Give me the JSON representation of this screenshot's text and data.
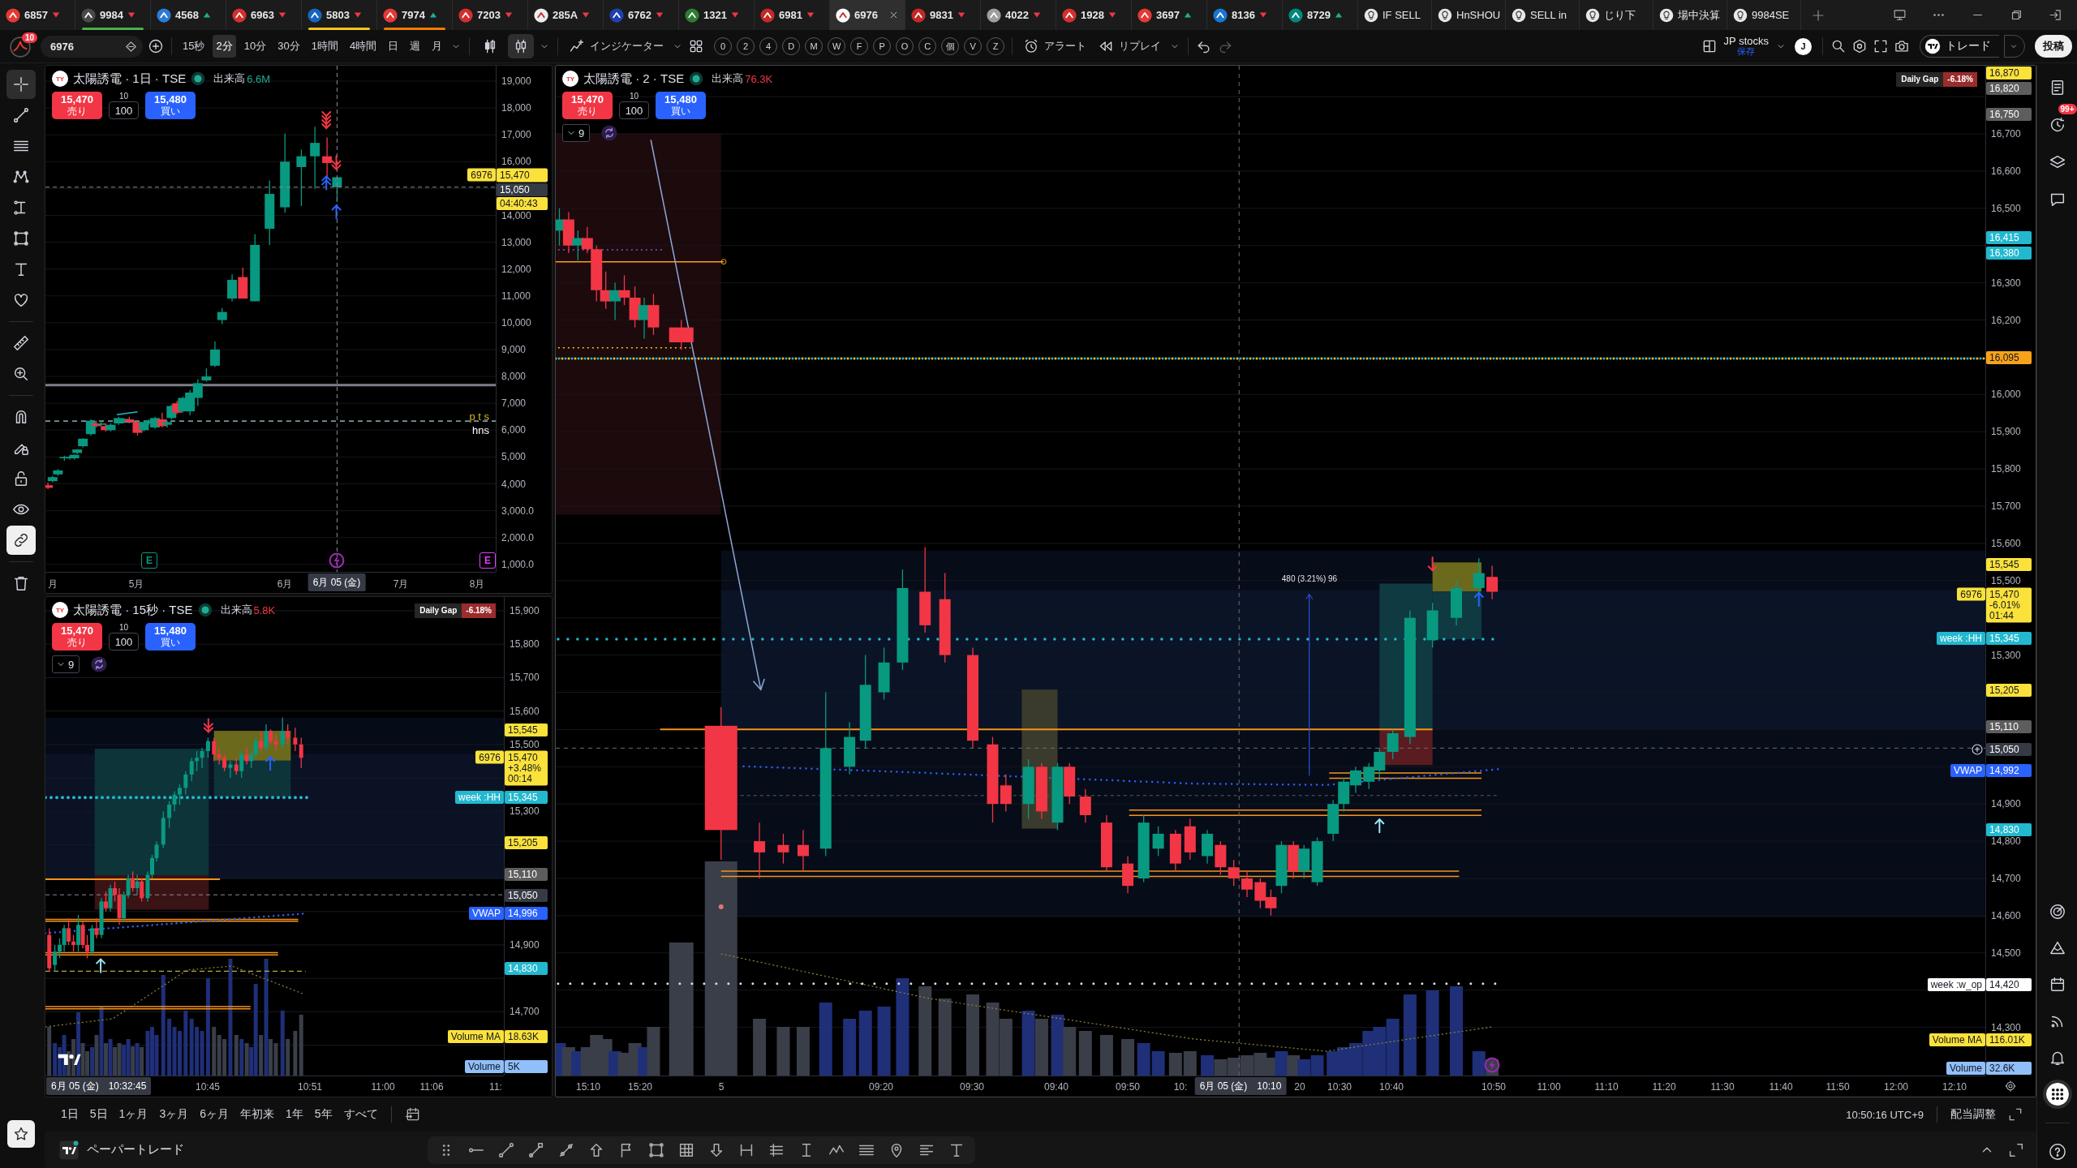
{
  "tabs": [
    {
      "kind": "symbol",
      "label": "6857",
      "rising": false,
      "selected": false
    },
    {
      "kind": "symbol",
      "label": "9984",
      "rising": false,
      "selected": false,
      "color": "#4caf50"
    },
    {
      "kind": "symbol",
      "label": "4568",
      "rising": true,
      "selected": false
    },
    {
      "kind": "symbol",
      "label": "6963",
      "rising": false,
      "selected": false
    },
    {
      "kind": "symbol",
      "label": "5803",
      "rising": false,
      "selected": false,
      "color": "#f5c518"
    },
    {
      "kind": "symbol",
      "label": "7974",
      "rising": true,
      "selected": false,
      "color": "#f57c00"
    },
    {
      "kind": "symbol",
      "label": "7203",
      "rising": false,
      "selected": false
    },
    {
      "kind": "symbol",
      "label": "285A",
      "rising": false,
      "selected": false
    },
    {
      "kind": "symbol",
      "label": "6762",
      "rising": false,
      "selected": false
    },
    {
      "kind": "symbol",
      "label": "1321",
      "rising": false,
      "selected": false
    },
    {
      "kind": "symbol",
      "label": "6981",
      "rising": false,
      "selected": false
    },
    {
      "kind": "symbol",
      "label": "6976",
      "selected": true
    },
    {
      "kind": "symbol",
      "label": "9831",
      "rising": false,
      "selected": false
    },
    {
      "kind": "symbol",
      "label": "4022",
      "rising": false,
      "selected": false
    },
    {
      "kind": "symbol",
      "label": "1928",
      "rising": false,
      "selected": false
    },
    {
      "kind": "symbol",
      "label": "3697",
      "rising": true,
      "selected": false
    },
    {
      "kind": "symbol",
      "label": "8136",
      "rising": false,
      "selected": false
    },
    {
      "kind": "symbol",
      "label": "8729",
      "rising": true,
      "selected": false
    },
    {
      "kind": "idea",
      "label": "IF SELL",
      "selected": false
    },
    {
      "kind": "idea",
      "label": "HnSHOU",
      "selected": false
    },
    {
      "kind": "idea",
      "label": "SELL in",
      "selected": false
    },
    {
      "kind": "idea",
      "label": "じり下",
      "selected": false
    },
    {
      "kind": "idea",
      "label": "場中決算",
      "selected": false
    },
    {
      "kind": "idea",
      "label": "9984SE",
      "selected": false
    }
  ],
  "toolbar": {
    "notifications": "10",
    "symbol": "6976",
    "intervals": [
      {
        "label": "15秒",
        "selected": false
      },
      {
        "label": "2分",
        "selected": true
      },
      {
        "label": "10分",
        "selected": false
      },
      {
        "label": "30分",
        "selected": false
      },
      {
        "label": "1時間",
        "selected": false
      },
      {
        "label": "4時間",
        "selected": false
      },
      {
        "label": "日",
        "selected": false
      },
      {
        "label": "週",
        "selected": false
      },
      {
        "label": "月",
        "selected": false
      }
    ],
    "chart_types": [
      {
        "kind": "candles",
        "selected": false
      },
      {
        "kind": "hollow-candles",
        "selected": true
      }
    ],
    "indicators": "インジケーター",
    "quick_buttons": [
      "0",
      "2",
      "4",
      "D",
      "M",
      "W",
      "F",
      "P",
      "O",
      "C",
      "個",
      "V",
      "Z"
    ],
    "alert": "アラート",
    "replay": "リプレイ",
    "layout_name": "JP stocks",
    "layout_status": "保存",
    "user_initial": "J",
    "trade": "トレード",
    "publish": "投稿"
  },
  "drawing_tools": [
    {
      "kind": "crosshair",
      "selected": true
    },
    {
      "kind": "trend-line",
      "selected": false
    },
    {
      "kind": "fib",
      "selected": false
    },
    {
      "kind": "pattern",
      "selected": false
    },
    {
      "kind": "projection",
      "selected": false
    },
    {
      "kind": "rectangle",
      "selected": false
    },
    {
      "kind": "text",
      "selected": false
    },
    {
      "kind": "favorites",
      "selected": false
    },
    {
      "kind": "ruler",
      "selected": false
    },
    {
      "kind": "zoom",
      "selected": false
    },
    {
      "kind": "magnet",
      "on": false
    },
    {
      "kind": "lock-drawing",
      "on": false
    },
    {
      "kind": "lock",
      "on": false
    },
    {
      "kind": "eye",
      "on": false
    },
    {
      "kind": "link",
      "on": true
    }
  ],
  "sidebar_top": [
    {
      "kind": "watchlist",
      "selected": false
    },
    {
      "kind": "alerts",
      "selected": false,
      "badge": "99+"
    },
    {
      "kind": "layers",
      "selected": false
    },
    {
      "kind": "chat",
      "selected": false
    }
  ],
  "sidebar_bottom": [
    {
      "kind": "target",
      "selected": false
    },
    {
      "kind": "pyramid",
      "selected": false
    },
    {
      "kind": "calendar",
      "selected": false
    },
    {
      "kind": "broadcast",
      "selected": false
    },
    {
      "kind": "bell",
      "selected": false
    },
    {
      "kind": "apps",
      "selected": true
    },
    {
      "kind": "help",
      "selected": false
    }
  ],
  "charts": [
    {
      "logo": "TY",
      "title": "太陽誘電 · 1日 · TSE",
      "market_open": true,
      "volume_label": "出来高",
      "volume": "6.6M",
      "volume_rising": true,
      "order": {
        "sell_price": "15,470",
        "sell_label": "売り",
        "step": "10",
        "quantity": "100",
        "buy_price": "15,480",
        "buy_label": "買い"
      },
      "price_ticks": [
        "19,000",
        "18,000",
        "17,000",
        "16,000",
        "14,000",
        "13,000",
        "12,000",
        "11,000",
        "10,000",
        "9,000",
        "8,000",
        "7,000",
        "6,000",
        "5,000",
        "4,000",
        "3,000.0",
        "2,000.0",
        "1,000.0"
      ],
      "price_labels": [
        {
          "kind": "last",
          "tag": "6976",
          "lines": [
            "15,470"
          ],
          "color": "#fbe23b"
        },
        {
          "kind": "crosshair",
          "text": "15,050"
        },
        {
          "kind": "level",
          "text": "04:40:43",
          "color": "#fbe23b"
        }
      ],
      "notes": [
        {
          "text": "p t s",
          "color": "#d4b82a"
        },
        {
          "text": "hns",
          "color": "#ffffff"
        }
      ],
      "events": [
        {
          "kind": "earnings",
          "label": "E",
          "color": "#089981"
        },
        {
          "kind": "flash",
          "color": "#9c27b0"
        },
        {
          "kind": "earnings",
          "label": "E",
          "color": "#e040fb"
        }
      ],
      "time_ticks": [
        "月",
        "5月",
        "6月",
        "7月",
        "8月"
      ],
      "crosshair_date": "6月 05 (金)"
    },
    {
      "logo": "TY",
      "title": "太陽誘電 · 15秒 · TSE",
      "market_open": true,
      "volume_label": "出来高",
      "volume": "5.8K",
      "volume_rising": false,
      "daily_gap": {
        "label": "Daily Gap",
        "value": "-6.18%"
      },
      "order": {
        "sell_price": "15,470",
        "sell_label": "売り",
        "step": "10",
        "quantity": "100",
        "buy_price": "15,480",
        "buy_label": "買い"
      },
      "indicators_count": "9",
      "price_ticks": [
        "15,900",
        "15,800",
        "15,700",
        "15,600",
        "15,500",
        "15,300",
        "14,900",
        "14,700"
      ],
      "price_labels": [
        {
          "kind": "level",
          "text": "15,545",
          "color": "#fbe23b"
        },
        {
          "kind": "last",
          "tag": "6976",
          "lines": [
            "15,470",
            "+3.48%",
            "00:14"
          ],
          "color": "#fbe23b"
        },
        {
          "kind": "tagged",
          "tag": "week :HH",
          "text": "15,345",
          "color": "#22b8cf"
        },
        {
          "kind": "level",
          "text": "15,205",
          "color": "#fbe23b"
        },
        {
          "kind": "level",
          "text": "15,110",
          "color": "#5d5d5d"
        },
        {
          "kind": "crosshair",
          "text": "15,050"
        },
        {
          "kind": "tagged",
          "tag": "VWAP",
          "text": "14,996",
          "color": "#2962ff"
        },
        {
          "kind": "level",
          "text": "14,830",
          "color": "#22b8cf"
        },
        {
          "kind": "tagged",
          "tag": "Volume MA",
          "text": "18.63K",
          "color": "#fbe23b"
        },
        {
          "kind": "tagged",
          "tag": "Volume",
          "text": "5K",
          "color": "#90bff9"
        }
      ],
      "time_ticks": [
        "10:45",
        "10:51",
        "11:00",
        "11:06",
        "11:"
      ],
      "crosshair_date": "6月 05 (金)",
      "crosshair_time": "10:32:45"
    },
    {
      "logo": "TY",
      "title": "太陽誘電 · 2 · TSE",
      "market_open": true,
      "volume_label": "出来高",
      "volume": "76.3K",
      "volume_rising": false,
      "daily_gap": {
        "label": "Daily Gap",
        "value": "-6.18%"
      },
      "order": {
        "sell_price": "15,470",
        "sell_label": "売り",
        "step": "10",
        "quantity": "100",
        "buy_price": "15,480",
        "buy_label": "買い"
      },
      "indicators_count": "9",
      "price_ticks": [
        "16,700",
        "16,600",
        "16,500",
        "16,300",
        "16,200",
        "16,000",
        "15,900",
        "15,800",
        "15,700",
        "15,600",
        "15,500",
        "15,300",
        "14,900",
        "14,800",
        "14,700",
        "14,600",
        "14,500",
        "14,300"
      ],
      "price_labels": [
        {
          "kind": "level",
          "text": "16,870",
          "color": "#fbe23b"
        },
        {
          "kind": "level",
          "text": "16,820",
          "color": "#5d5d5d"
        },
        {
          "kind": "level",
          "text": "16,750",
          "color": "#5d5d5d"
        },
        {
          "kind": "level",
          "text": "16,415",
          "color": "#22b8cf"
        },
        {
          "kind": "level",
          "text": "16,380",
          "color": "#22b8cf"
        },
        {
          "kind": "level",
          "text": "16,095",
          "color": "#f7a21b"
        },
        {
          "kind": "level",
          "text": "15,545",
          "color": "#fbe23b"
        },
        {
          "kind": "last",
          "tag": "6976",
          "lines": [
            "15,470",
            "-6.01%",
            "01:44"
          ],
          "color": "#fbe23b"
        },
        {
          "kind": "tagged",
          "tag": "week :HH",
          "text": "15,345",
          "color": "#22b8cf"
        },
        {
          "kind": "level",
          "text": "15,205",
          "color": "#fbe23b"
        },
        {
          "kind": "level",
          "text": "15,110",
          "color": "#5d5d5d"
        },
        {
          "kind": "crosshair",
          "text": "15,050"
        },
        {
          "kind": "tagged",
          "tag": "VWAP",
          "text": "14,992",
          "color": "#2962ff"
        },
        {
          "kind": "level",
          "text": "14,830",
          "color": "#22b8cf"
        },
        {
          "kind": "tagged",
          "tag": "week :w_op",
          "text": "14,420",
          "color": "#ffffff"
        },
        {
          "kind": "tagged",
          "tag": "Volume MA",
          "text": "116.01K",
          "color": "#fbe23b"
        },
        {
          "kind": "tagged",
          "tag": "Volume",
          "text": "32.6K",
          "color": "#90bff9"
        }
      ],
      "annotation": "480 (3.21%) 96",
      "events": [
        {
          "kind": "flash",
          "color": "#9c27b0"
        }
      ],
      "time_ticks": [
        "15:10",
        "15:20",
        "5",
        "09:20",
        "09:30",
        "09:40",
        "09:50",
        "10:",
        "20",
        "10:30",
        "10:40",
        "10:50",
        "11:00",
        "11:10",
        "11:20",
        "11:30",
        "11:40",
        "11:50",
        "12:00",
        "12:10"
      ],
      "crosshair_date": "6月 05 (金)",
      "crosshair_time": "10:10"
    }
  ],
  "range_bar": {
    "ranges": [
      "1日",
      "5日",
      "1ヶ月",
      "3ヶ月",
      "6ヶ月",
      "年初来",
      "1年",
      "5年",
      "すべて"
    ],
    "clock": "10:50:16 UTC+9",
    "adjustment": "配当調整"
  },
  "footer": {
    "label": "ペーパートレード"
  }
}
